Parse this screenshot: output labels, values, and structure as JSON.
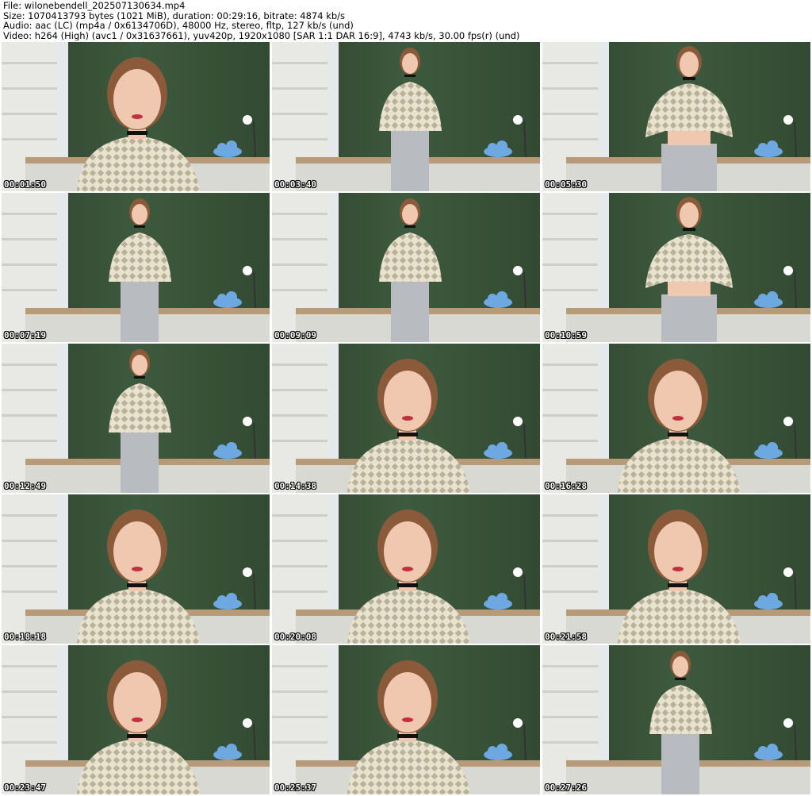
{
  "header": {
    "file_line": "File: wilonebendell_202507130634.mp4",
    "size_line": "Size: 1070413793 bytes (1021 MiB), duration: 00:29:16, bitrate: 4874 kb/s",
    "audio_line": "Audio: aac (LC) (mp4a / 0x6134706D), 48000 Hz, stereo, fltp, 127 kb/s (und)",
    "video_line": "Video: h264 (High) (avc1 / 0x31637661), yuv420p, 1920x1080 [SAR 1:1 DAR 16:9], 4743 kb/s, 30.00 fps(r) (und)"
  },
  "colors": {
    "curtain": "#3e5a3e",
    "wall": "#e8e8e4",
    "shelf": "#f2f2ee",
    "desk": "#b79a78",
    "cloud": "#6ea8e0",
    "sweater": "#e9e2cf",
    "pattern": "#8f8a6e",
    "skin": "#f0c8b0",
    "hair": "#8a5a3a",
    "jeans": "#b8bcc0"
  },
  "thumbnails": [
    {
      "timestamp": "00:01:50",
      "shot": "close"
    },
    {
      "timestamp": "00:03:40",
      "shot": "full"
    },
    {
      "timestamp": "00:05:30",
      "shot": "mid"
    },
    {
      "timestamp": "00:07:19",
      "shot": "full"
    },
    {
      "timestamp": "00:09:09",
      "shot": "full"
    },
    {
      "timestamp": "00:10:59",
      "shot": "mid"
    },
    {
      "timestamp": "00:12:49",
      "shot": "full"
    },
    {
      "timestamp": "00:14:38",
      "shot": "close"
    },
    {
      "timestamp": "00:16:28",
      "shot": "close"
    },
    {
      "timestamp": "00:18:18",
      "shot": "close"
    },
    {
      "timestamp": "00:20:08",
      "shot": "close"
    },
    {
      "timestamp": "00:21:58",
      "shot": "close"
    },
    {
      "timestamp": "00:23:47",
      "shot": "close"
    },
    {
      "timestamp": "00:25:37",
      "shot": "close"
    },
    {
      "timestamp": "00:27:26",
      "shot": "full"
    }
  ]
}
